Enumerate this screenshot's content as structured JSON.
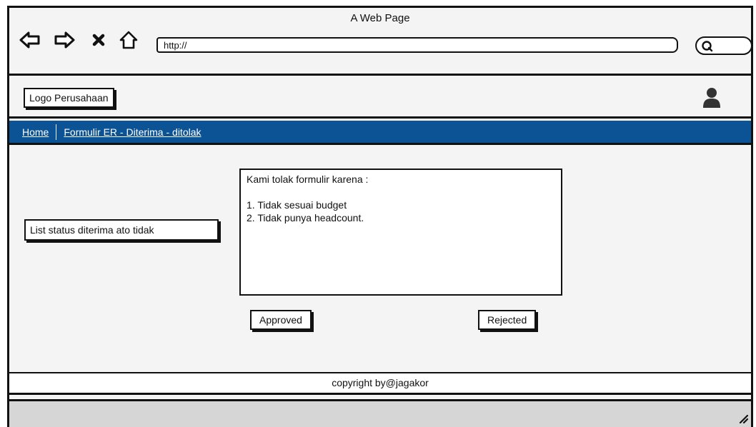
{
  "window": {
    "title": "A Web Page"
  },
  "browser": {
    "url": "http://",
    "icons": [
      "back-arrow-icon",
      "forward-arrow-icon",
      "stop-icon",
      "home-icon",
      "search-icon"
    ]
  },
  "header": {
    "logo_text": "Logo Perusahaan",
    "user_icon": "user-icon"
  },
  "breadcrumb": {
    "items": [
      "Home",
      "Formulir ER - Diterima - ditolak"
    ]
  },
  "main": {
    "status_list_label": "List status diterima ato tidak",
    "reason": {
      "lines": [
        "Kami tolak formulir karena :",
        "",
        "1. Tidak sesuai budget",
        "2. Tidak punya headcount."
      ]
    },
    "approved_label": "Approved",
    "rejected_label": "Rejected"
  },
  "footer": {
    "text": "copyright by@jagakor"
  },
  "colors": {
    "nav_bar": "#0b5394",
    "nav_text": "#ffffff"
  }
}
